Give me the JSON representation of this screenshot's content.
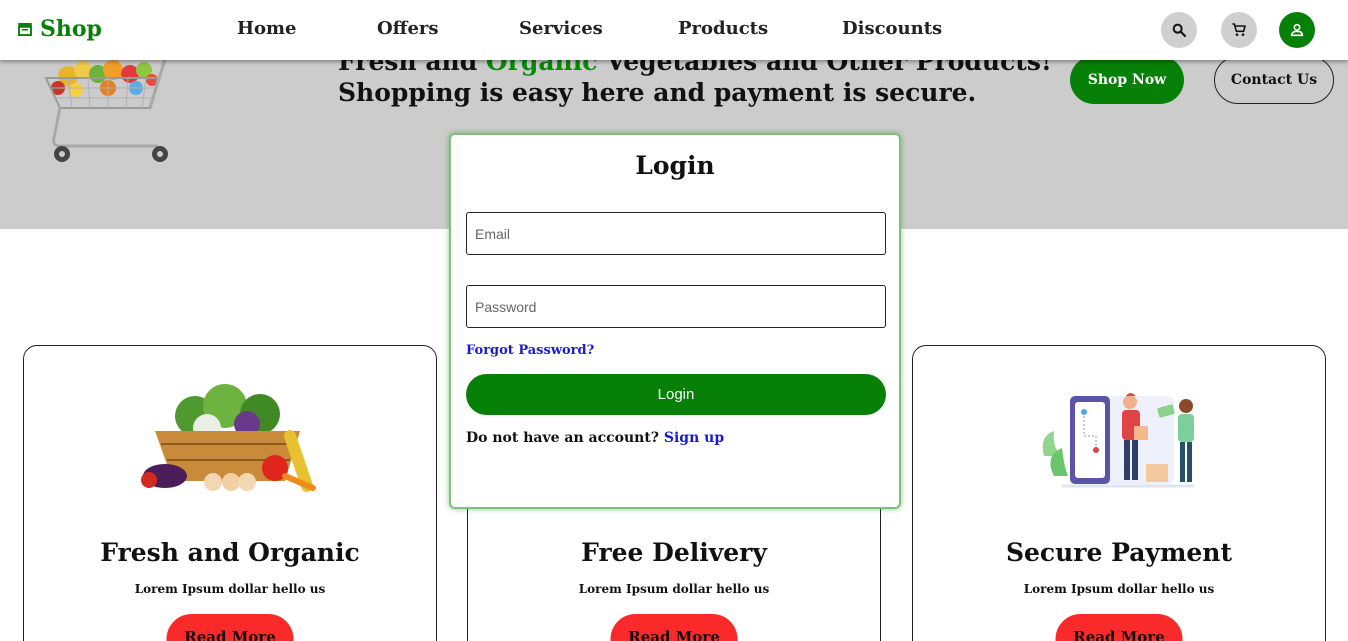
{
  "navbar": {
    "brand": "Shop",
    "links": [
      "Home",
      "Offers",
      "Services",
      "Products",
      "Discounts"
    ],
    "icons": [
      "search-icon",
      "cart-icon",
      "user-icon"
    ],
    "accent": "#078007"
  },
  "hero": {
    "line1_before": "Fresh and ",
    "line1_highlight": "Organic",
    "line1_after": " Vegetables and Other Products!",
    "line2": "Shopping is easy here and payment is secure.",
    "shop_now": "Shop Now",
    "contact_us": "Contact Us",
    "background": "#cccccc"
  },
  "login": {
    "title": "Login",
    "email_placeholder": "Email",
    "password_placeholder": "Password",
    "forgot": "Forgot Password?",
    "button": "Login",
    "no_account": "Do not have an account?",
    "signup": "Sign up"
  },
  "cards": [
    {
      "title": "Fresh and Organic",
      "text": "Lorem Ipsum dollar hello us",
      "button": "Read More"
    },
    {
      "title": "Free Delivery",
      "text": "Lorem Ipsum dollar hello us",
      "button": "Read More"
    },
    {
      "title": "Secure Payment",
      "text": "Lorem Ipsum dollar hello us",
      "button": "Read More"
    }
  ],
  "colors": {
    "primary_green": "#078007",
    "read_more_red": "#fb2a2a",
    "link_blue": "#1a1ad0"
  }
}
